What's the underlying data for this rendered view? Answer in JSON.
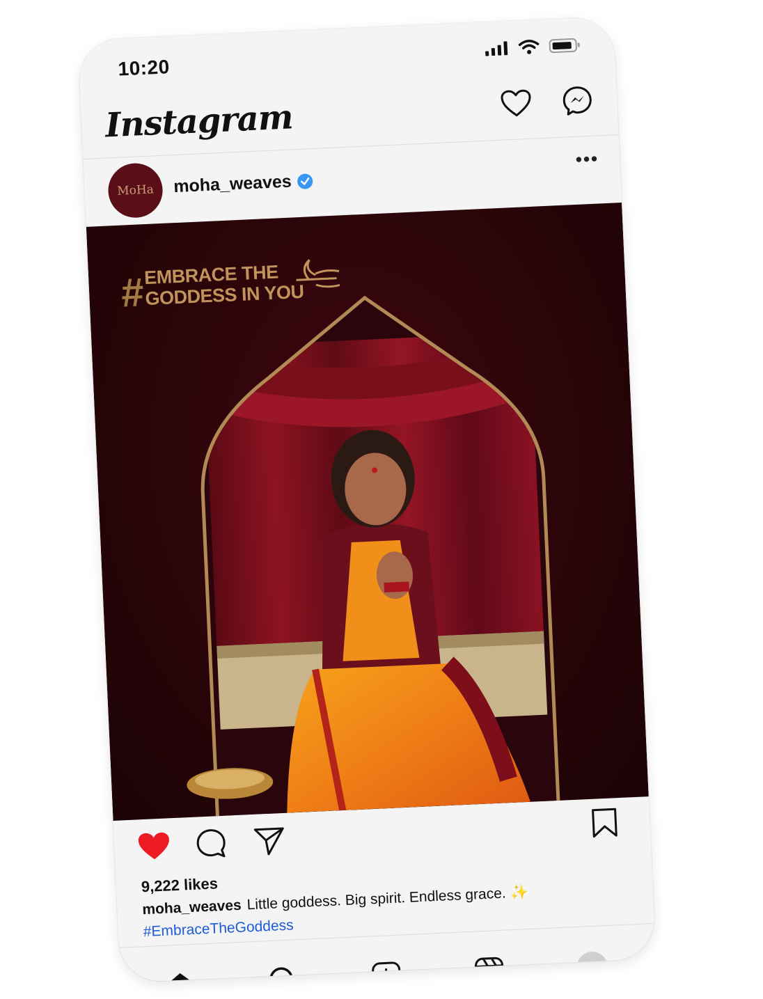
{
  "status_bar": {
    "time": "10:20"
  },
  "app": {
    "name": "Instagram"
  },
  "post": {
    "avatar_text": "MoHa",
    "username": "moha_weaves",
    "verified": true,
    "more_label": "•••",
    "image": {
      "hashtag_symbol": "#",
      "tagline_line1": "EMBRACE THE",
      "tagline_line2": "GODDESS IN YOU"
    },
    "likes": "9,222 likes",
    "caption_user": "moha_weaves",
    "caption_text": "Little goddess. Big spirit. Endless grace.",
    "caption_emoji": "✨",
    "hashtag": "#EmbraceTheGoddess",
    "liked": true
  },
  "colors": {
    "like_red": "#ed1c24",
    "brand_maroon": "#5a0f18",
    "gold": "#c0935a",
    "hashtag_blue": "#1e5bd6",
    "verified_blue": "#3897f0"
  },
  "icons": {
    "header": [
      "heart-icon",
      "messenger-icon"
    ],
    "actions": [
      "heart-filled-icon",
      "comment-icon",
      "share-icon",
      "bookmark-icon"
    ],
    "nav": [
      "home-icon",
      "search-icon",
      "add-icon",
      "reels-icon",
      "profile-avatar"
    ]
  }
}
